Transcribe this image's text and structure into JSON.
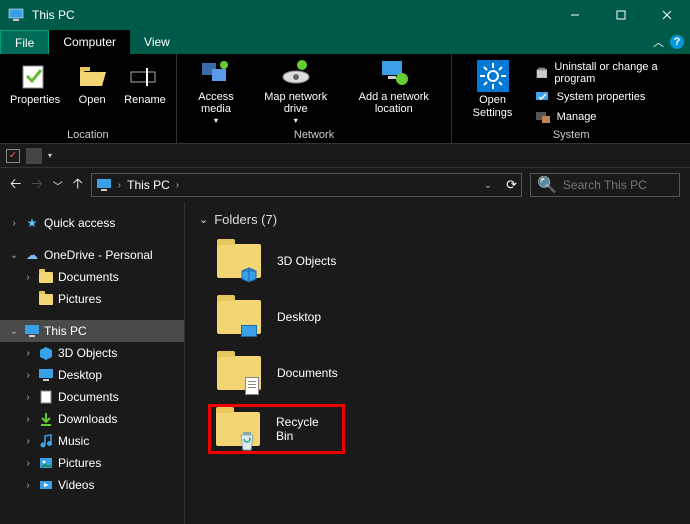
{
  "title": "This PC",
  "tabs": {
    "file": "File",
    "computer": "Computer",
    "view": "View"
  },
  "ribbon": {
    "location": {
      "properties": "Properties",
      "open": "Open",
      "rename": "Rename",
      "label": "Location"
    },
    "network": {
      "access_media": "Access media",
      "map_drive": "Map network drive",
      "add_location": "Add a network location",
      "label": "Network"
    },
    "system": {
      "open_settings": "Open Settings",
      "uninstall": "Uninstall or change a program",
      "sys_props": "System properties",
      "manage": "Manage",
      "label": "System"
    }
  },
  "nav": {
    "crumb": "This PC",
    "refresh_aria": "Refresh",
    "search_placeholder": "Search This PC"
  },
  "tree": {
    "quick_access": "Quick access",
    "onedrive": "OneDrive - Personal",
    "onedrive_children": [
      "Documents",
      "Pictures"
    ],
    "this_pc": "This PC",
    "this_pc_children": [
      "3D Objects",
      "Desktop",
      "Documents",
      "Downloads",
      "Music",
      "Pictures",
      "Videos"
    ]
  },
  "content": {
    "section": "Folders (7)",
    "items": [
      "3D Objects",
      "Desktop",
      "Documents",
      "Recycle Bin"
    ]
  }
}
